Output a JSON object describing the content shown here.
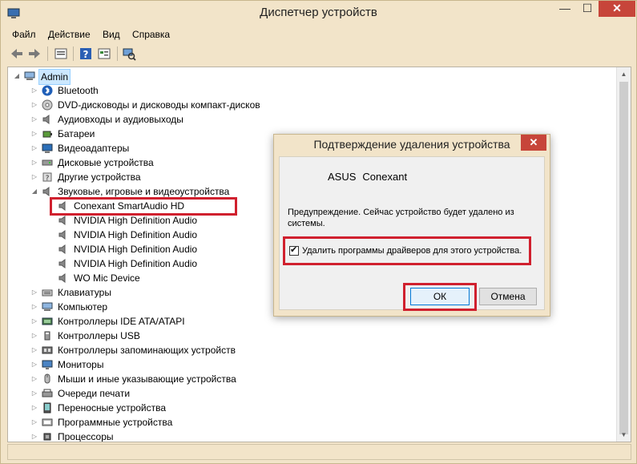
{
  "window": {
    "title": "Диспетчер устройств",
    "min": "—",
    "max": "☐",
    "close": "✕"
  },
  "menu": [
    "Файл",
    "Действие",
    "Вид",
    "Справка"
  ],
  "tree": {
    "root": "Admin",
    "items": [
      {
        "label": "Bluetooth",
        "icon": "bluetooth-icon",
        "expanded": false
      },
      {
        "label": "DVD-дисководы и дисководы компакт-дисков",
        "icon": "disc-drive-icon",
        "expanded": false
      },
      {
        "label": "Аудиовходы и аудиовыходы",
        "icon": "speaker-icon",
        "expanded": false
      },
      {
        "label": "Батареи",
        "icon": "battery-icon",
        "expanded": false
      },
      {
        "label": "Видеоадаптеры",
        "icon": "display-adapter-icon",
        "expanded": false
      },
      {
        "label": "Дисковые устройства",
        "icon": "disk-drive-icon",
        "expanded": false
      },
      {
        "label": "Другие устройства",
        "icon": "unknown-device-icon",
        "expanded": false
      },
      {
        "label": "Звуковые, игровые и видеоустройства",
        "icon": "speaker-icon",
        "expanded": true
      },
      {
        "label": "Клавиатуры",
        "icon": "keyboard-icon",
        "expanded": false
      },
      {
        "label": "Компьютер",
        "icon": "computer-icon",
        "expanded": false
      },
      {
        "label": "Контроллеры IDE ATA/ATAPI",
        "icon": "controller-icon",
        "expanded": false
      },
      {
        "label": "Контроллеры USB",
        "icon": "usb-icon",
        "expanded": false
      },
      {
        "label": "Контроллеры запоминающих устройств",
        "icon": "storage-controller-icon",
        "expanded": false
      },
      {
        "label": "Мониторы",
        "icon": "monitor-icon",
        "expanded": false
      },
      {
        "label": "Мыши и иные указывающие устройства",
        "icon": "mouse-icon",
        "expanded": false
      },
      {
        "label": "Очереди печати",
        "icon": "printer-icon",
        "expanded": false
      },
      {
        "label": "Переносные устройства",
        "icon": "portable-device-icon",
        "expanded": false
      },
      {
        "label": "Программные устройства",
        "icon": "software-device-icon",
        "expanded": false
      },
      {
        "label": "Процессоры",
        "icon": "processor-icon",
        "expanded": false
      }
    ],
    "sound_children": [
      "Conexant SmartAudio HD",
      "NVIDIA High Definition Audio",
      "NVIDIA High Definition Audio",
      "NVIDIA High Definition Audio",
      "NVIDIA High Definition Audio",
      "WO Mic Device"
    ]
  },
  "dialog": {
    "title": "Подтверждение удаления устройства",
    "device_vendor": "ASUS",
    "device_name": "Conexant",
    "warning": "Предупреждение. Сейчас устройство будет удалено из системы.",
    "checkbox_label": "Удалить программы драйверов для этого устройства.",
    "checkbox_checked": true,
    "ok_label": "ОК",
    "cancel_label": "Отмена",
    "close": "✕"
  },
  "colors": {
    "highlight": "#d0202e",
    "frame": "#f2e4c9",
    "close_button": "#c7453a"
  }
}
